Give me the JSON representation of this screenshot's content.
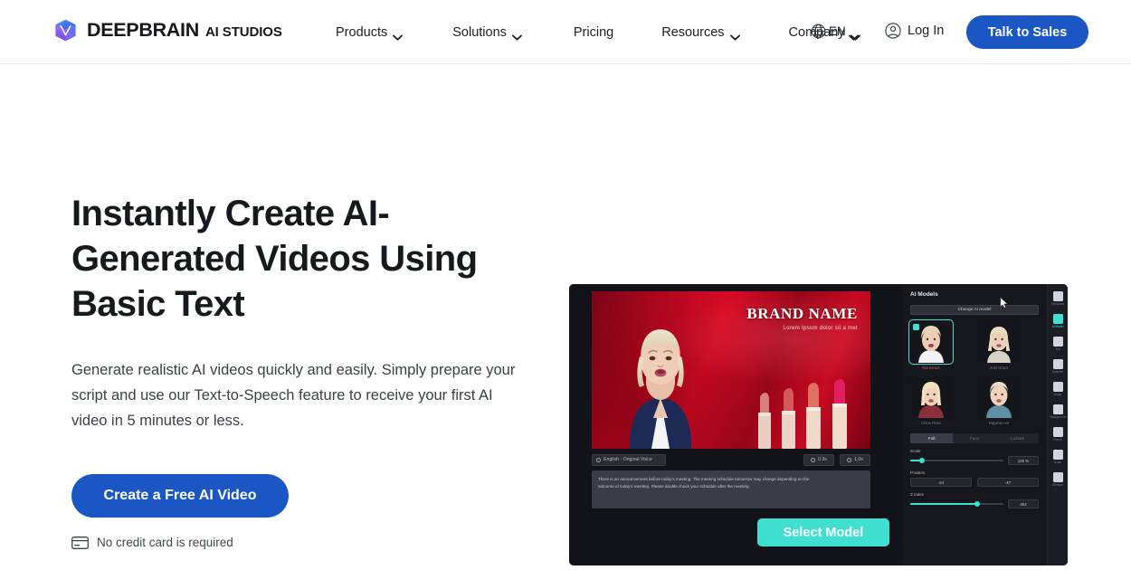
{
  "brand": {
    "logo_icon": "cube-logo-icon",
    "name": "DEEPBRAIN",
    "sub": "AI STUDIOS"
  },
  "nav": {
    "items": [
      {
        "label": "Products",
        "has_dropdown": true,
        "icon": "chevron-down-icon"
      },
      {
        "label": "Solutions",
        "has_dropdown": true,
        "icon": "chevron-down-icon"
      },
      {
        "label": "Pricing",
        "has_dropdown": false,
        "icon": ""
      },
      {
        "label": "Resources",
        "has_dropdown": true,
        "icon": "chevron-down-icon"
      },
      {
        "label": "Company",
        "has_dropdown": true,
        "icon": "chevron-down-icon"
      }
    ],
    "language": {
      "icon": "globe-icon",
      "code": "EN",
      "chevron": "chevron-down-icon"
    },
    "login": {
      "icon": "user-circle-icon",
      "label": "Log In"
    },
    "cta": {
      "label": "Talk to Sales"
    }
  },
  "hero": {
    "headline": "Instantly Create AI-Generated Videos Using Basic Text",
    "subcopy": "Generate realistic AI videos quickly and easily. Simply prepare your script and use our Text-to-Speech feature to receive your first AI video in 5 minutes or less.",
    "cta_label": "Create a Free AI Video",
    "note": {
      "icon": "credit-card-icon",
      "text": "No credit card is required"
    }
  },
  "app_mock": {
    "canvas": {
      "brand_title": "BRAND NAME",
      "brand_tagline": "Lorem Ipsum dolor sit a met",
      "avatar_alt": "ai-presenter-avatar",
      "product_alt": "lipstick-products"
    },
    "controls": {
      "language_chip": {
        "icon": "voice-icon",
        "label": "English - Original Voice"
      },
      "duration_chips": [
        {
          "icon": "clock-icon",
          "label": "0.3s"
        },
        {
          "icon": "clock-icon",
          "label": "1.0s"
        }
      ]
    },
    "script": {
      "line1": "There is an announcement before today's meeting. The meeting schedule tomorrow may change depending on the",
      "line2": "outcome of today's meeting. Please double check your schedule after the meeting."
    },
    "select_model_button": "Select Model",
    "side_panel": {
      "title": "AI Models",
      "change_button": "Change AI model",
      "models": [
        {
          "name": "Mia Brown",
          "selected": true
        },
        {
          "name": "Ariel Grace",
          "selected": false
        },
        {
          "name": "Chloe Rose",
          "selected": false
        },
        {
          "name": "Dayana Lee",
          "selected": false
        }
      ],
      "view_tabs": [
        {
          "label": "Full",
          "active": true
        },
        {
          "label": "Face",
          "active": false
        },
        {
          "label": "Custom",
          "active": false
        }
      ],
      "settings": {
        "scale": {
          "label": "Scale",
          "value": "100 %",
          "fill_pct": 12
        },
        "position": {
          "label": "Position",
          "x_label": "X",
          "x_value": "-24",
          "y_label": "Y",
          "y_value": "-47"
        },
        "z_index": {
          "label": "Z index",
          "value": "404",
          "fill_pct": 72
        }
      },
      "rail_items": [
        {
          "icon": "template-icon",
          "label": "Templates",
          "active": false
        },
        {
          "icon": "ai-model-icon",
          "label": "AI Model",
          "active": true
        },
        {
          "icon": "text-icon",
          "label": "Text",
          "active": false
        },
        {
          "icon": "subtitle-icon",
          "label": "Subtitles",
          "active": false
        },
        {
          "icon": "image-icon",
          "label": "Image",
          "active": false
        },
        {
          "icon": "background-icon",
          "label": "Background",
          "active": false
        },
        {
          "icon": "frame-icon",
          "label": "Frame",
          "active": false
        },
        {
          "icon": "audio-icon",
          "label": "Audio",
          "active": false
        },
        {
          "icon": "element-icon",
          "label": "Element",
          "active": false
        }
      ],
      "cursor": "mouse-pointer-icon"
    }
  },
  "colors": {
    "brand_blue": "#1a56c4",
    "accent_teal": "#3fe0d0",
    "text_dark": "#16191d",
    "app_dark": "#121318"
  }
}
